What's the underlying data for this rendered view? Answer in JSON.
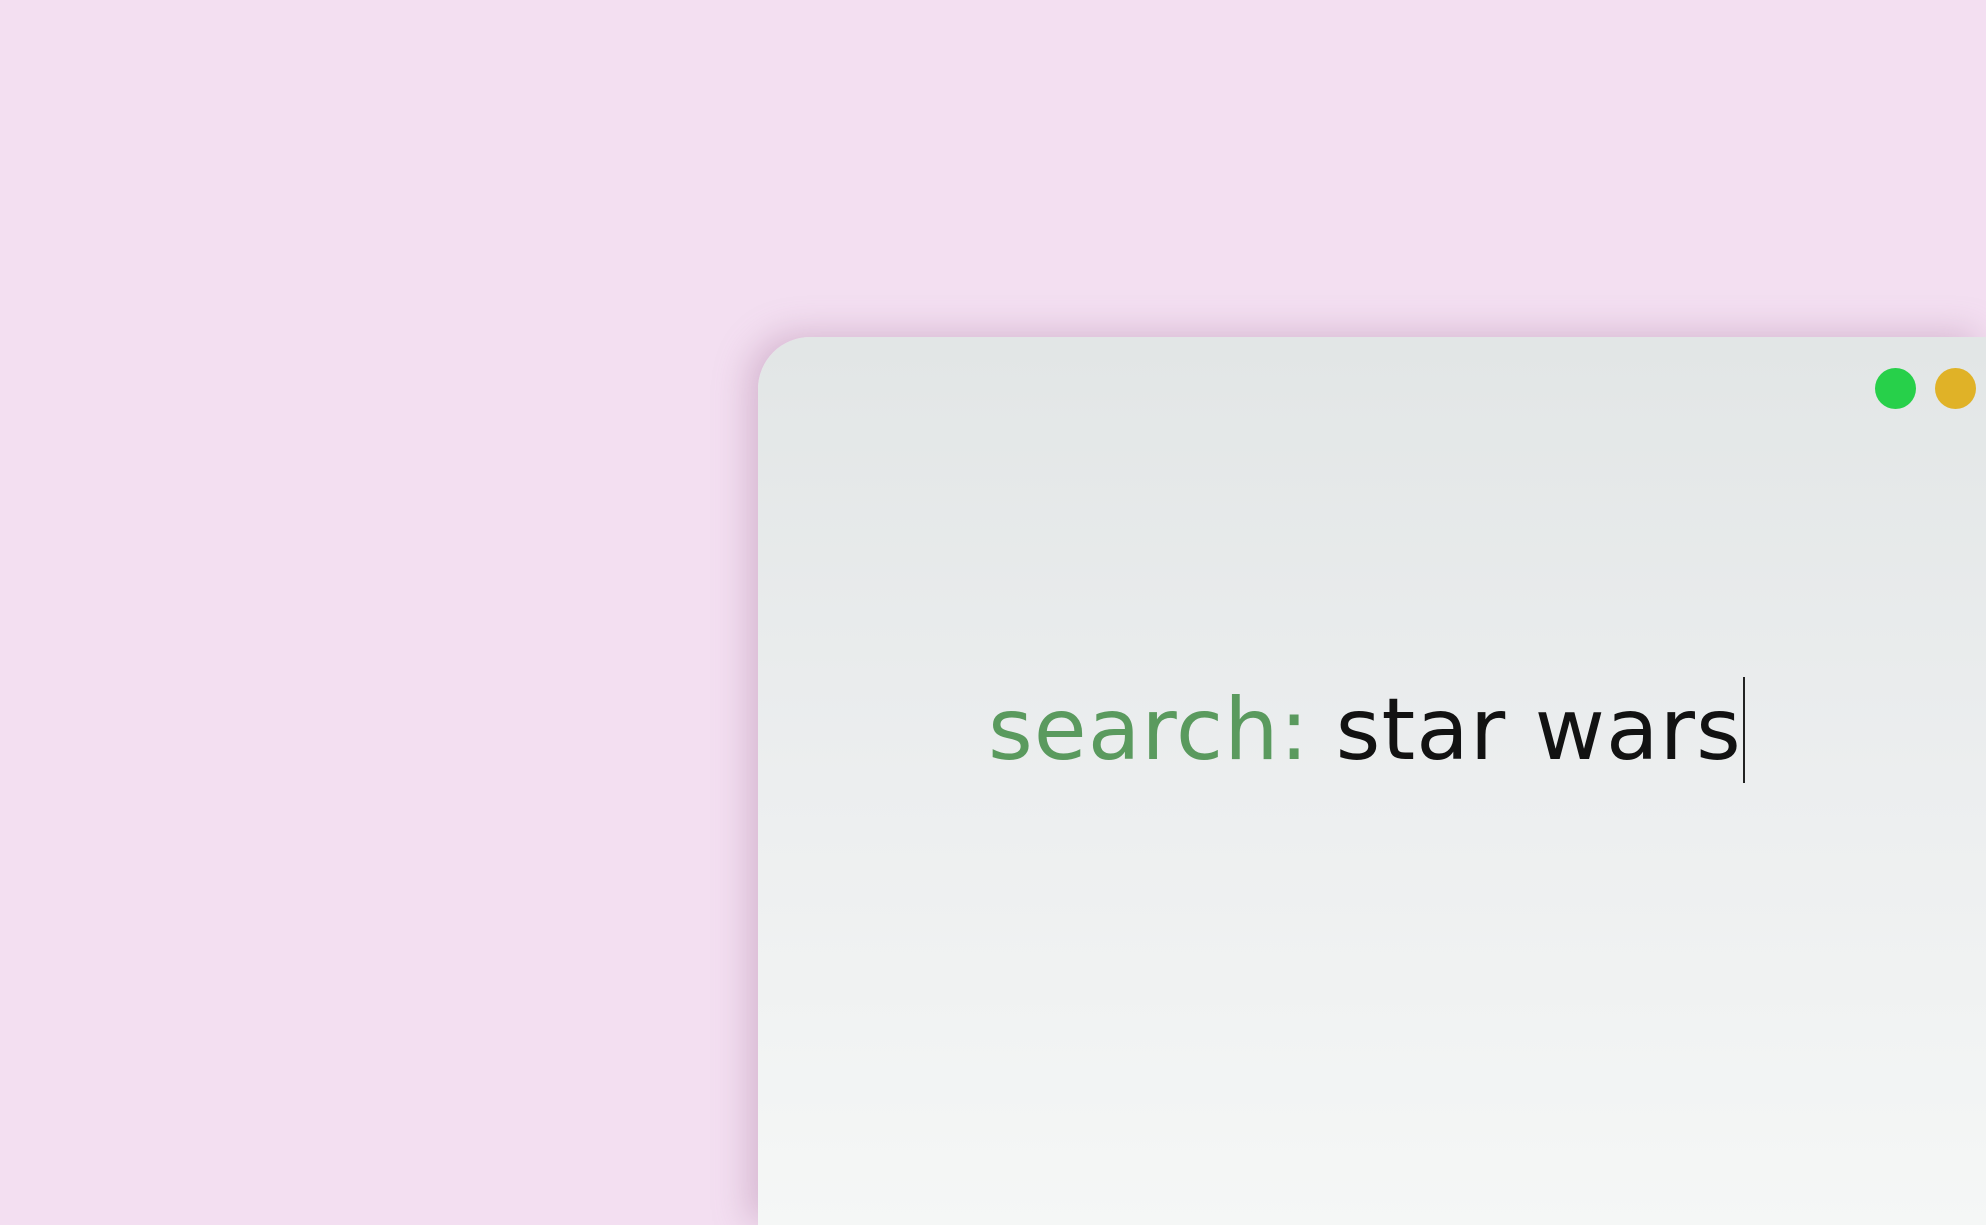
{
  "window": {
    "controls": [
      {
        "name": "green-dot",
        "color": "#27d04a"
      },
      {
        "name": "yellow-dot",
        "color": "#e0b227"
      }
    ]
  },
  "search": {
    "label": "search:",
    "value": "star wars",
    "label_color": "#5a9a5e"
  }
}
